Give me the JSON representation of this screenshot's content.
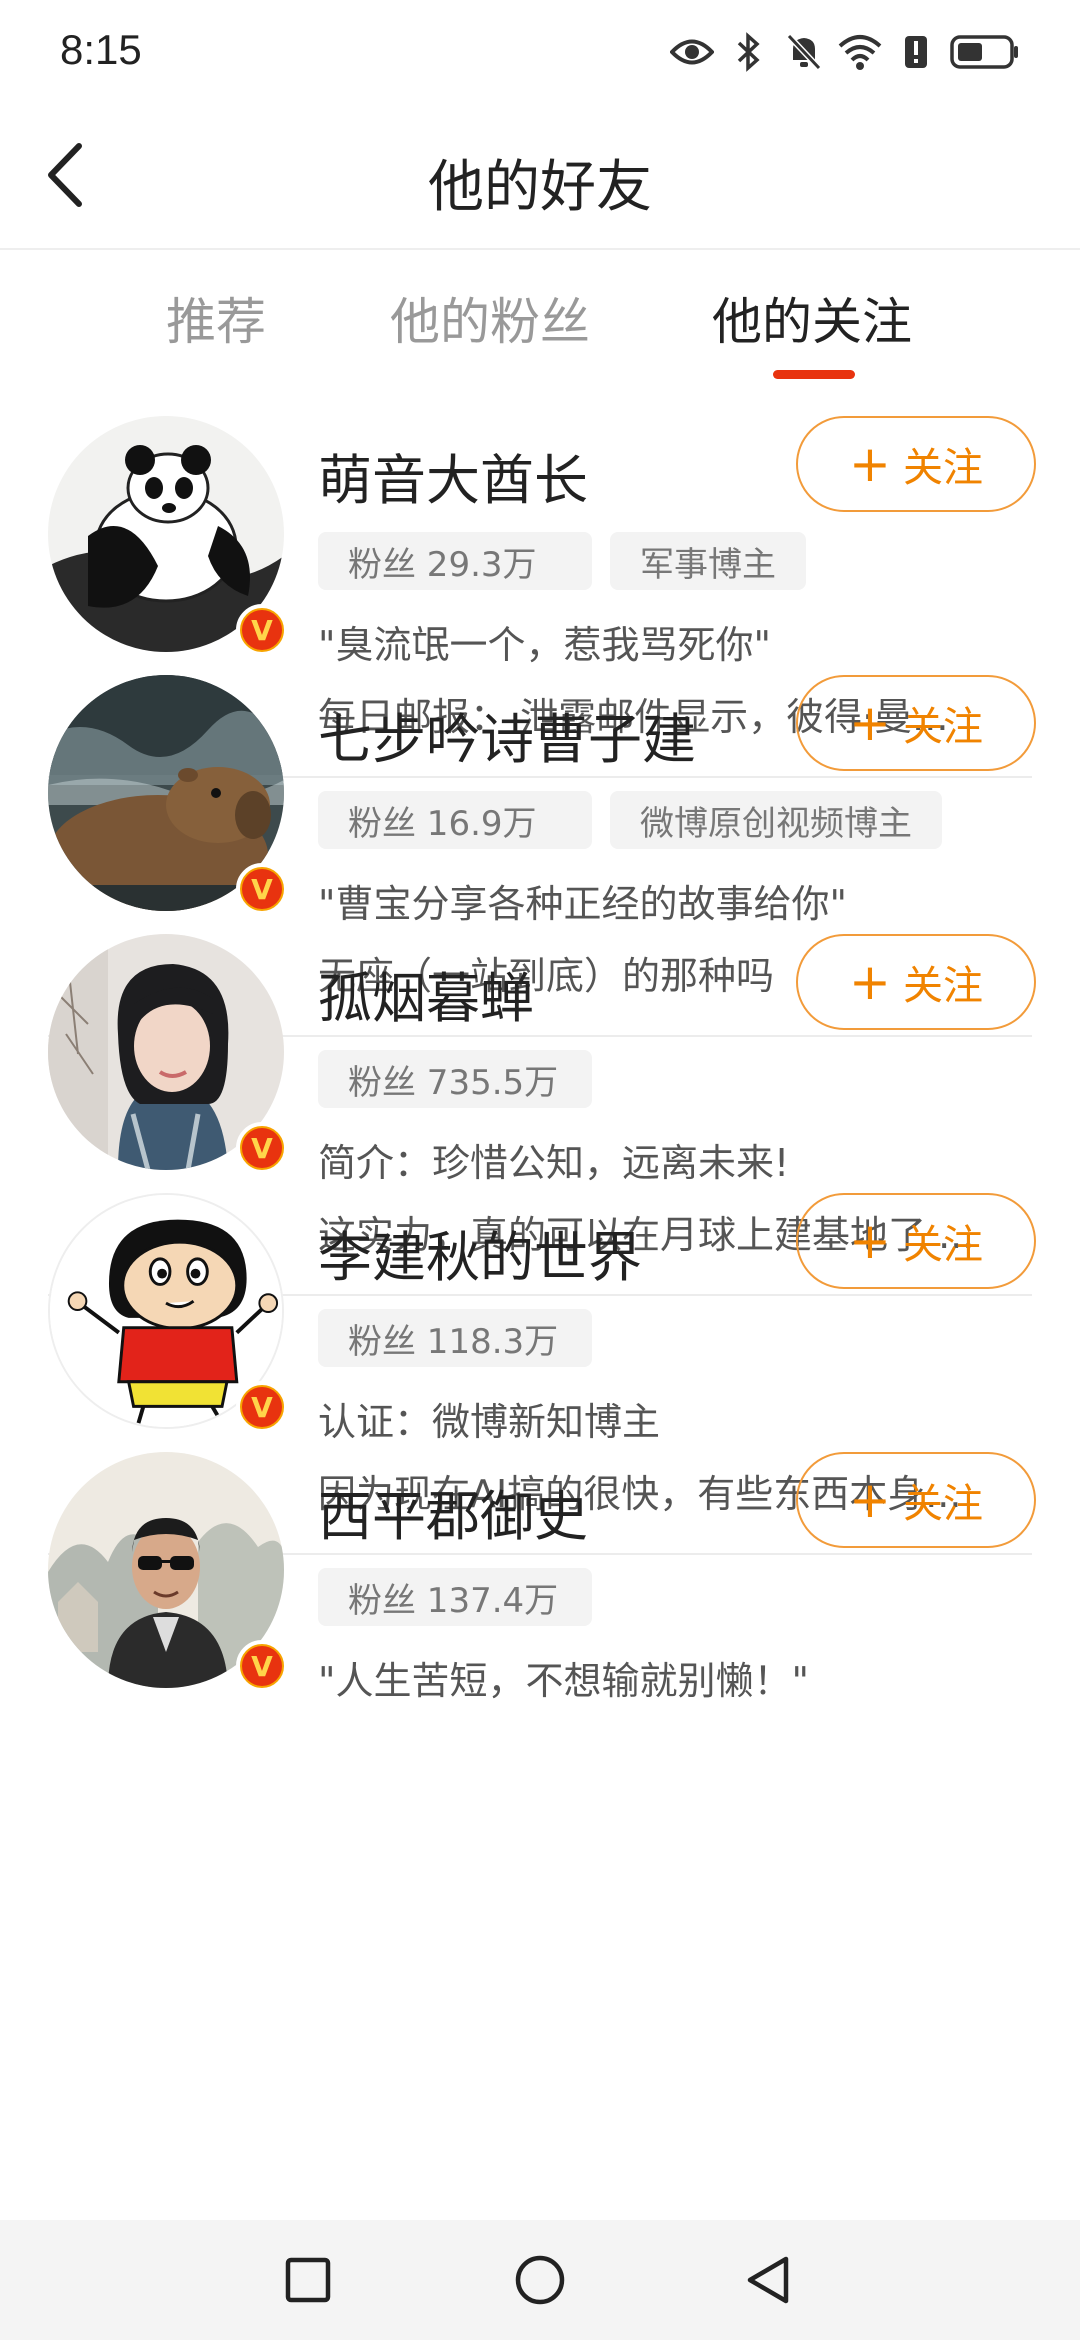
{
  "status_bar": {
    "time": "8:15",
    "icons": [
      "eye-icon",
      "bluetooth-icon",
      "mute-icon",
      "wifi-icon",
      "alert-icon",
      "battery-icon"
    ]
  },
  "header": {
    "title": "他的好友",
    "back_icon": "back-arrow-icon"
  },
  "tabs": [
    {
      "label": "推荐",
      "active": false
    },
    {
      "label": "他的粉丝",
      "active": false
    },
    {
      "label": "他的关注",
      "active": true
    }
  ],
  "colors": {
    "accent": "#e8330f",
    "follow": "#f08300",
    "vip_badge": "#f7a400"
  },
  "follow_label": "关注",
  "users": [
    {
      "name": "萌音大酋长",
      "fans": "粉丝 29.3万",
      "tag": "军事博主",
      "line1": "\"臭流氓一个，惹我骂死你\"",
      "line2": "每日邮报： 泄露邮件显示，彼得·曼...",
      "verified": true,
      "avatar": "panda-ink-painting"
    },
    {
      "name": "七步吟诗曹子建",
      "fans": "粉丝 16.9万",
      "tag": "微博原创视频博主",
      "line1": "\"曹宝分享各种正经的故事给你\"",
      "line2": "无座（一站到底）的那种吗",
      "verified": true,
      "avatar": "capybara-photo"
    },
    {
      "name": "孤烟暮蝉",
      "fans": "粉丝 735.5万",
      "tag": "",
      "line1": "简介：珍惜公知，远离未来!",
      "line2": "这实力，真的可以在月球上建基地了 ...",
      "verified": true,
      "avatar": "woman-portrait"
    },
    {
      "name": "李建秋的世界",
      "fans": "粉丝 118.3万",
      "tag": "",
      "line1": "认证：微博新知博主",
      "line2": "因为现在AI搞的很快，有些东西本身...",
      "verified": true,
      "avatar": "cartoon-boy"
    },
    {
      "name": "西平郡御史",
      "fans": "粉丝 137.4万",
      "tag": "",
      "line1": "\"人生苦短，不想输就别懒！\"",
      "line2": "",
      "verified": true,
      "avatar": "man-sunglasses-painting"
    }
  ],
  "nav_bar": {
    "icons": [
      "recent-apps-icon",
      "home-icon",
      "back-icon"
    ]
  }
}
